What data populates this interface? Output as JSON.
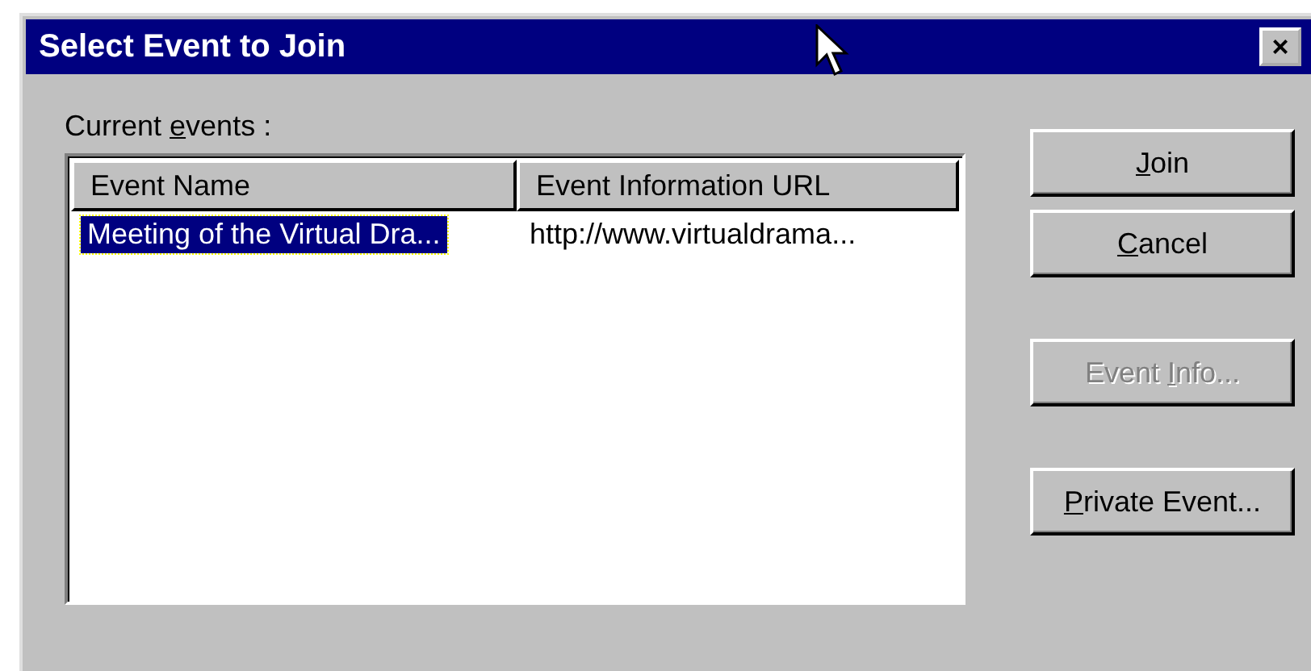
{
  "window": {
    "title": "Select Event to Join",
    "close": "×"
  },
  "list_label": {
    "before": "Current ",
    "key": "e",
    "after": "vents :"
  },
  "table": {
    "columns": [
      "Event Name",
      "Event Information URL"
    ],
    "rows": [
      {
        "cells": [
          "Meeting of the Virtual Dra...",
          "http://www.virtualdrama..."
        ],
        "selected": true
      }
    ]
  },
  "buttons": [
    {
      "key": "J",
      "after": "oin",
      "disabled": false,
      "kind": "normal"
    },
    {
      "key": "C",
      "after": "ancel",
      "disabled": false,
      "kind": "normal"
    },
    {
      "before": "Event ",
      "key": "I",
      "after": "nfo...",
      "disabled": true,
      "kind": "spaced"
    },
    {
      "key": "P",
      "after": "rivate Event...",
      "disabled": false,
      "kind": "spaced"
    }
  ]
}
